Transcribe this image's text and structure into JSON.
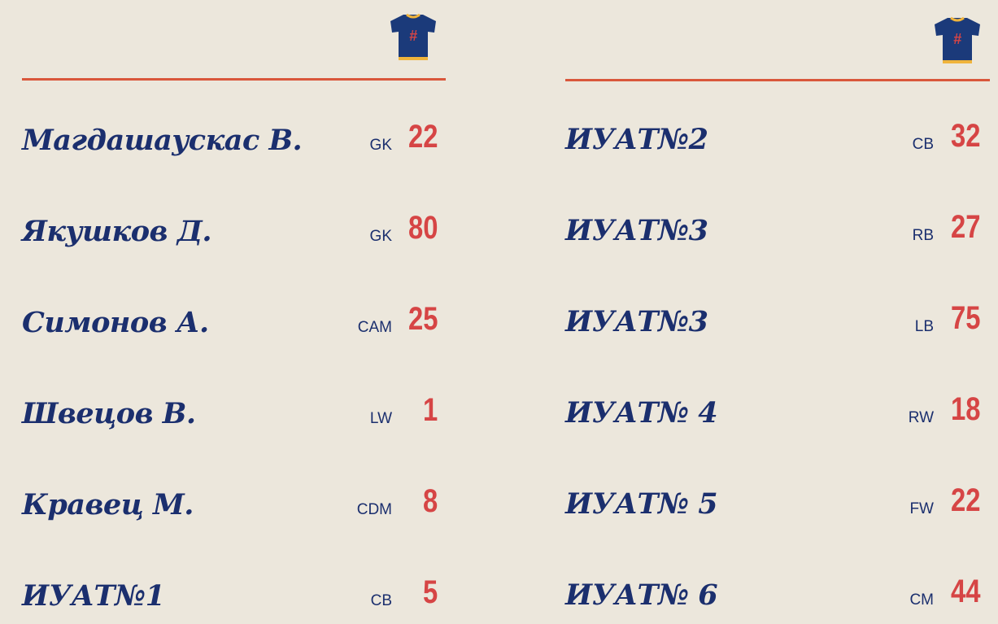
{
  "icons": {
    "jersey": "jersey-hash-icon"
  },
  "colors": {
    "background": "#ece7dc",
    "name_text": "#1b2f6e",
    "number_text": "#d64545",
    "divider": "#d9573b",
    "jersey_body": "#1b3a7a",
    "jersey_trim": "#f0b43c"
  },
  "left_roster": {
    "jersey_symbol": "#",
    "players": [
      {
        "name": "Магдашаускас В.",
        "position": "GK",
        "number": "22"
      },
      {
        "name": "Якушков Д.",
        "position": "GK",
        "number": "80"
      },
      {
        "name": "Симонов А.",
        "position": "CAM",
        "number": "25"
      },
      {
        "name": "Швецов В.",
        "position": "LW",
        "number": "1"
      },
      {
        "name": "Кравец М.",
        "position": "CDM",
        "number": "8"
      },
      {
        "name": "ИУАТ№1",
        "position": "CB",
        "number": "5"
      }
    ]
  },
  "right_roster": {
    "jersey_symbol": "#",
    "players": [
      {
        "name": "ИУАТ№2",
        "position": "CB",
        "number": "32"
      },
      {
        "name": "ИУАТ№3",
        "position": "RB",
        "number": "27"
      },
      {
        "name": "ИУАТ№3",
        "position": "LB",
        "number": "75"
      },
      {
        "name": "ИУАТ№ 4",
        "position": "RW",
        "number": "18"
      },
      {
        "name": "ИУАТ№ 5",
        "position": "FW",
        "number": "22"
      },
      {
        "name": "ИУАТ№ 6",
        "position": "CM",
        "number": "44"
      }
    ]
  }
}
